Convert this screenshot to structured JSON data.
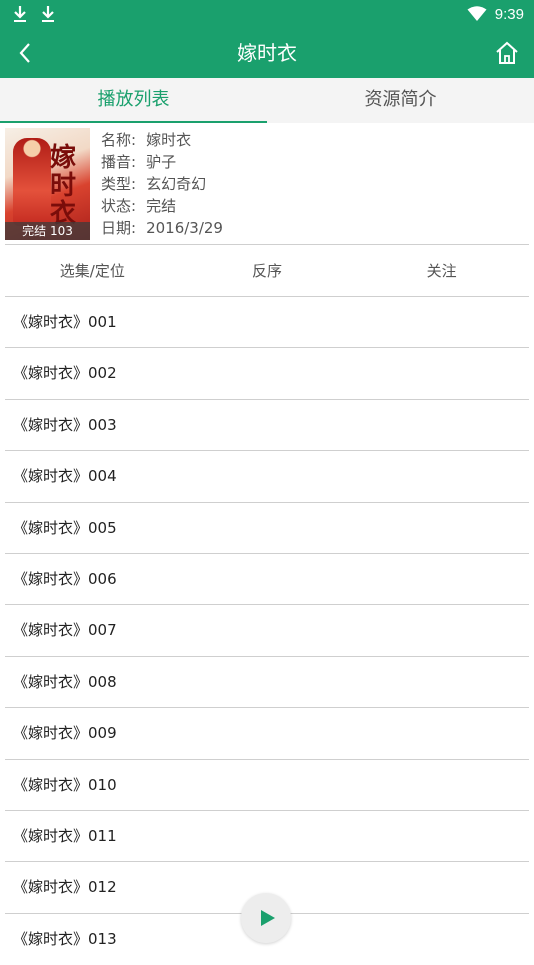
{
  "status_bar": {
    "time": "9:39"
  },
  "app_bar": {
    "title": "嫁时衣"
  },
  "tabs": [
    {
      "label": "播放列表",
      "active": true
    },
    {
      "label": "资源简介",
      "active": false
    }
  ],
  "info": {
    "cover_badge": "完结 103",
    "cover_text": "嫁时衣",
    "rows": [
      {
        "key": "名称:",
        "value": "嫁时衣"
      },
      {
        "key": "播音:",
        "value": "驴子"
      },
      {
        "key": "类型:",
        "value": "玄幻奇幻"
      },
      {
        "key": "状态:",
        "value": "完结"
      },
      {
        "key": "日期:",
        "value": "2016/3/29"
      }
    ]
  },
  "actions": {
    "select": "选集/定位",
    "reverse": "反序",
    "follow": "关注"
  },
  "episodes": [
    "《嫁时衣》001",
    "《嫁时衣》002",
    "《嫁时衣》003",
    "《嫁时衣》004",
    "《嫁时衣》005",
    "《嫁时衣》006",
    "《嫁时衣》007",
    "《嫁时衣》008",
    "《嫁时衣》009",
    "《嫁时衣》010",
    "《嫁时衣》011",
    "《嫁时衣》012",
    "《嫁时衣》013"
  ],
  "colors": {
    "accent": "#1aa06d",
    "divider": "#cfcfcf",
    "tab_bg": "#f4f4f4"
  },
  "icons": [
    "download-icon",
    "wifi-icon",
    "back-arrow-icon",
    "home-icon",
    "play-icon"
  ]
}
